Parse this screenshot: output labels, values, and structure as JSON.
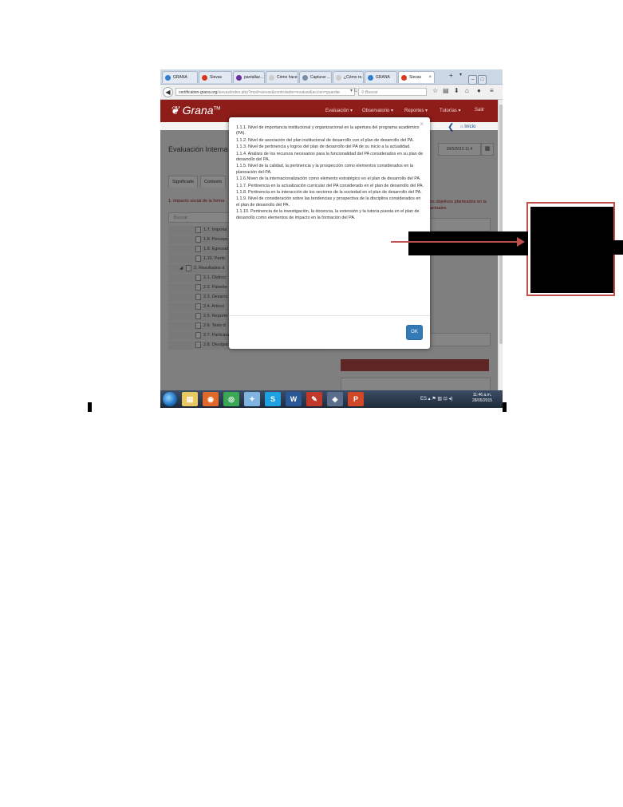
{
  "browser": {
    "tabs": [
      {
        "label": "GRANA",
        "color": "#2f7fd1",
        "active": false
      },
      {
        "label": "Sievas",
        "color": "#d9371c",
        "active": false
      },
      {
        "label": "pantallaz...",
        "color": "#6a2fa0",
        "active": false
      },
      {
        "label": "Cómo hacer ...",
        "color": "#cccccc",
        "active": false
      },
      {
        "label": "Capturar ...",
        "color": "#7a8ea8",
        "active": false
      },
      {
        "label": "¿Cómo re...",
        "color": "#cccccc",
        "active": false
      },
      {
        "label": "GRANA",
        "color": "#2f7fd1",
        "active": false
      },
      {
        "label": "Sievas",
        "color": "#d9371c",
        "active": true
      }
    ],
    "new_tab": "+",
    "url_host": "certification-grana.org",
    "url_path": "/sievas/index.php?mod=sievas&controlador=evaluar&accion=guardar",
    "search_placeholder": "Buscar",
    "nav_icons": [
      "star-icon",
      "clipboard-icon",
      "download-icon",
      "home-icon",
      "chat-icon",
      "menu-icon"
    ]
  },
  "app": {
    "logo": "Grana",
    "logo_mark": "TM",
    "menu": [
      "Evaluación ▾",
      "Observatorio ▾",
      "Reportes ▾",
      "Tutorías ▾",
      "Salir"
    ],
    "home_label": "Inicio",
    "eval_title": "Evaluación Interna :: L",
    "date": "28/5/2015 11:4",
    "tabs": [
      "Significado",
      "Contexto"
    ],
    "impacto_label": "1. Impacto social de la forma",
    "right_note": "os objetivos planteados en la actuales",
    "search_placeholder": "Buscar",
    "tree": [
      {
        "text": "1.7. Importa",
        "indent": 2,
        "caret": false
      },
      {
        "text": "1.8. Percepc",
        "indent": 2,
        "caret": false
      },
      {
        "text": "1.9. Egresad",
        "indent": 2,
        "caret": false
      },
      {
        "text": "1.10. Partic",
        "indent": 2,
        "caret": false
      },
      {
        "text": "2. Resultados d",
        "indent": 1,
        "caret": true
      },
      {
        "text": "2.1. Distinci",
        "indent": 2,
        "caret": false
      },
      {
        "text": "2.2. Patente",
        "indent": 2,
        "caret": false
      },
      {
        "text": "2.3. Desarro",
        "indent": 2,
        "caret": false
      },
      {
        "text": "2.4. Articul",
        "indent": 2,
        "caret": false
      },
      {
        "text": "2.5. Reporte",
        "indent": 2,
        "caret": false
      },
      {
        "text": "2.6. Tesis d",
        "indent": 2,
        "caret": false
      },
      {
        "text": "2.7. Participación en congresos y en grupos nacionales",
        "indent": 2,
        "caret": false
      },
      {
        "text": "2.8. Divulgación y difusión",
        "indent": 2,
        "caret": false
      }
    ]
  },
  "modal": {
    "close": "×",
    "items": [
      "1.1.1. Nivel de importancia institucional y organizacional en la apertura del programa académico (PA).",
      "1.1.2. Nivel de asociación del plan institucional de desarrollo con el plan de desarrollo del PA.",
      "1.1.3. Nivel de pertinencia y logros del plan de desarrollo del PA de su inicio a la actualidad.",
      "1.1.4. Análisis de los recursos necesarios para la funcionalidad del PA considerados en su plan de desarrollo del PA.",
      "1.1.5. Nivel de la calidad, la pertinencia y la prospección como elementos considerados en la planeación del PA.",
      "1.1.6.Niven de la internacionalización como elemento estratégico en el plan de desarrollo del PA.",
      "1.1.7. Pertinencia en la actualización curricular del PA considerado en el plan de desarrollo del PA.",
      "1.1.8. Pertinencia en la interacción de los sectores de la sociedad en el plan de desarrollo del PA.",
      "1.1.9. Nivel de consideración sobre las tendencias y prospectiva de la disciplina considerados en el plan de desarrollo del PA.",
      "1.1.10. Pertinencia de la investigación, la docencia, la extensión y la tutoría puesta en el plan de desarrollo como elementos de impacto en la formación del PA."
    ],
    "ok_label": "OK"
  },
  "taskbar": {
    "apps": [
      {
        "icon": "explorer-icon",
        "glyph": "▤",
        "color": "#e8c860"
      },
      {
        "icon": "firefox-icon",
        "glyph": "◉",
        "color": "#e0692a"
      },
      {
        "icon": "chrome-icon",
        "glyph": "◎",
        "color": "#3aa757"
      },
      {
        "icon": "bird-icon",
        "glyph": "✦",
        "color": "#7fb4e0"
      },
      {
        "icon": "skype-icon",
        "glyph": "S",
        "color": "#1da1e2"
      },
      {
        "icon": "word-icon",
        "glyph": "W",
        "color": "#2b5797"
      },
      {
        "icon": "pdf-icon",
        "glyph": "✎",
        "color": "#c0392b"
      },
      {
        "icon": "media-icon",
        "glyph": "◈",
        "color": "#5a6e8c"
      },
      {
        "icon": "powerpoint-icon",
        "glyph": "P",
        "color": "#d24726"
      }
    ],
    "tray": "ES ▴ ⚑ ▥ ⊡ ◂)",
    "time": "11:46 a.m.",
    "date": "28/05/2015"
  },
  "colors": {
    "brand": "#8e1d1a",
    "annotation": "#c0504d",
    "ok_button": "#337ab7"
  }
}
